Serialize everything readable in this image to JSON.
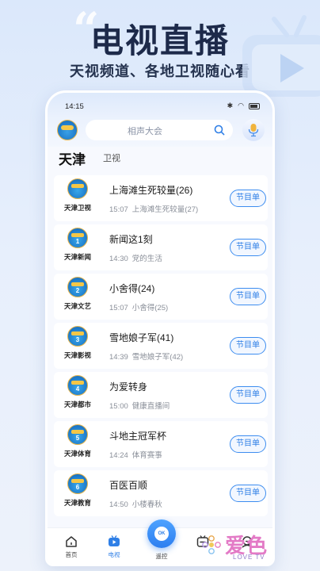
{
  "promo": {
    "quote": "“",
    "title": "电视直播",
    "subtitle": "天视频道、各地卫视随心看"
  },
  "status_bar": {
    "time": "14:15",
    "battery": "80"
  },
  "topbar": {
    "search_placeholder": "相声大会"
  },
  "region": {
    "title": "天津",
    "subtitle": "卫视"
  },
  "channels": [
    {
      "name": "天津卫视",
      "badge": "",
      "program": "上海滩生死较量(26)",
      "next_time": "15:07",
      "next_program": "上海滩生死较量(27)",
      "button": "节目单"
    },
    {
      "name": "天津新闻",
      "badge": "1",
      "program": "新闻这1刻",
      "next_time": "14:30",
      "next_program": "党的生活",
      "button": "节目单"
    },
    {
      "name": "天津文艺",
      "badge": "2",
      "program": "小舍得(24)",
      "next_time": "15:07",
      "next_program": "小舍得(25)",
      "button": "节目单"
    },
    {
      "name": "天津影视",
      "badge": "3",
      "program": "雪地娘子军(41)",
      "next_time": "14:39",
      "next_program": "雪地娘子军(42)",
      "button": "节目单"
    },
    {
      "name": "天津都市",
      "badge": "4",
      "program": "为爱转身",
      "next_time": "15:00",
      "next_program": "健康直播间",
      "button": "节目单"
    },
    {
      "name": "天津体育",
      "badge": "5",
      "program": "斗地主冠军杯",
      "next_time": "14:24",
      "next_program": "体育赛事",
      "button": "节目单"
    },
    {
      "name": "天津教育",
      "badge": "6",
      "program": "百医百顺",
      "next_time": "14:50",
      "next_program": "小楼春秋",
      "button": "节目单"
    }
  ],
  "bottom_nav": {
    "home": "首页",
    "tv": "电视",
    "remote": "遥控",
    "remote_ok": "OK",
    "items": [
      "首页",
      "电视",
      "遥控",
      "",
      ""
    ]
  },
  "watermark": {
    "text": "爱色",
    "sub": "LOVE TV"
  },
  "colors": {
    "accent": "#2f7fe6",
    "background": "#e3ecfb",
    "watermark": "#e37ac6"
  }
}
